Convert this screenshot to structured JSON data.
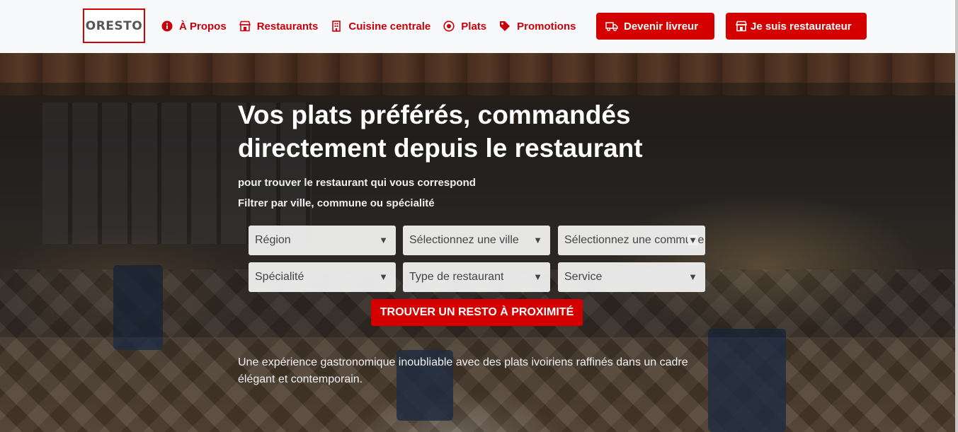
{
  "brand": {
    "logo_text": "ORESTO",
    "accent_color": "#d40000"
  },
  "nav": {
    "items": [
      {
        "label": "À Propos",
        "icon": "info-circle-icon"
      },
      {
        "label": "Restaurants",
        "icon": "store-icon"
      },
      {
        "label": "Cuisine centrale",
        "icon": "building-icon"
      },
      {
        "label": "Plats",
        "icon": "plate-icon"
      },
      {
        "label": "Promotions",
        "icon": "tag-icon"
      }
    ],
    "buttons": {
      "livreur": {
        "label": "Devenir livreur",
        "icon": "truck-icon"
      },
      "restaurateur": {
        "label": "Je suis restaurateur",
        "icon": "store-icon"
      }
    }
  },
  "hero": {
    "title": "Vos plats préférés, commandés directement depuis le restaurant",
    "subtitle1": "pour trouver le restaurant qui vous correspond",
    "subtitle2": "Filtrer par ville, commune ou spécialité",
    "filters": {
      "region": "Région",
      "ville": "Sélectionnez une ville",
      "commune": "Sélectionnez une commune",
      "specialite": "Spécialité",
      "type": "Type de restaurant",
      "service": "Service"
    },
    "caret": "▼",
    "cta_label": "TROUVER UN RESTO À PROXIMITÉ",
    "description": "Une expérience gastronomique inoubliable avec des plats ivoiriens raffinés dans un cadre élégant et contemporain."
  }
}
